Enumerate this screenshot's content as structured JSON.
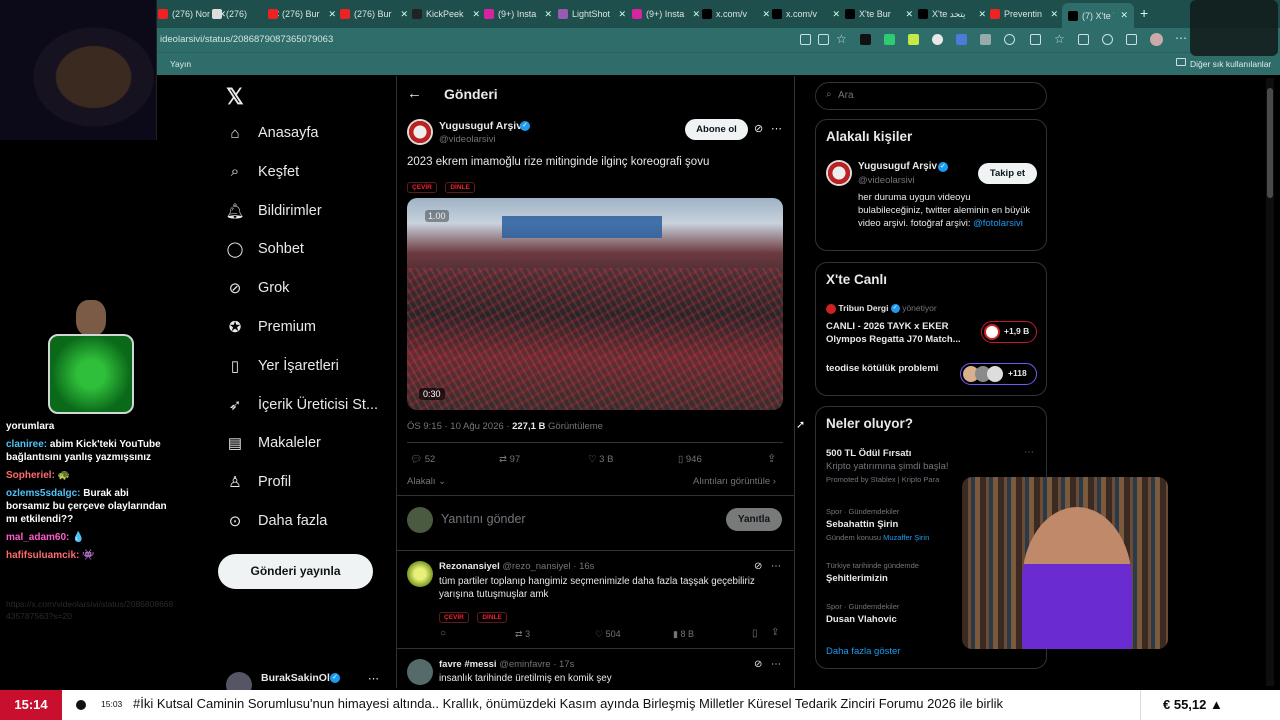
{
  "browser": {
    "tabs": [
      {
        "label": "(276) Nor"
      },
      {
        "label": "(276)"
      },
      {
        "label": "(276) Bur"
      },
      {
        "label": "(276) Bur"
      },
      {
        "label": "KickPeek"
      },
      {
        "label": "(9+) Insta"
      },
      {
        "label": "LightShot"
      },
      {
        "label": "(9+) Insta"
      },
      {
        "label": "x.com/v"
      },
      {
        "label": "x.com/v"
      },
      {
        "label": "X'te Bur"
      },
      {
        "label": "X'te يتحد"
      },
      {
        "label": "Preventin"
      },
      {
        "label": "(7) X'te Y"
      }
    ],
    "url": "ideolarsivi/status/2086879087365079063",
    "bookmark_left": "Yayın",
    "bookmark_right": "Diğer sık kullanılanlar"
  },
  "nav": {
    "items": [
      {
        "label": "Anasayfa",
        "icon": "home-icon"
      },
      {
        "label": "Keşfet",
        "icon": "search-icon"
      },
      {
        "label": "Bildirimler",
        "icon": "bell-icon"
      },
      {
        "label": "Sohbet",
        "icon": "chat-icon"
      },
      {
        "label": "Grok",
        "icon": "grok-icon"
      },
      {
        "label": "Premium",
        "icon": "premium-icon"
      },
      {
        "label": "Yer İşaretleri",
        "icon": "bookmark-icon"
      },
      {
        "label": "İçerik Üreticisi St...",
        "icon": "rocket-icon"
      },
      {
        "label": "Makaleler",
        "icon": "article-icon"
      },
      {
        "label": "Profil",
        "icon": "profile-icon"
      },
      {
        "label": "Daha fazla",
        "icon": "more-icon"
      }
    ],
    "post_button": "Gönderi yayınla",
    "account_name": "BurakSakinOl"
  },
  "main": {
    "header_title": "Gönderi",
    "tweet": {
      "author_name": "Yugusuguf Arşiv",
      "author_handle": "@videolarsivi",
      "subscribe": "Abone ol",
      "text": "2023 ekrem imamoğlu rize mitinginde ilginç koreografi şovu",
      "tag_translate": "ÇEVİR",
      "tag_listen": "DİNLE",
      "video_speed": "1.00",
      "video_duration": "0:30",
      "time": "ÖS 9:15 · 10 Ağu 2026 · ",
      "views": "227,1 B",
      "views_label": " Görüntüleme",
      "replies": "52",
      "retweets": "97",
      "likes": "3 B",
      "bookmarks": "946",
      "related": "Alakalı",
      "quotes": "Alıntıları görüntüle"
    },
    "reply_box": {
      "placeholder": "Yanıtını gönder",
      "button": "Yanıtla"
    },
    "replies": [
      {
        "name": "Rezonansiyel",
        "handle": "@rezo_nansiyel · 16s",
        "text": "tüm partiler toplanıp hangimiz seçmenimizle daha fazla taşşak geçebiliriz yarışına tutuşmuşlar amk",
        "retweets": "3",
        "likes": "504",
        "views": "8 B"
      },
      {
        "name": "favre #messi",
        "handle": "@eminfavre · 17s",
        "text": "insanlık tarihinde üretilmiş en komik şey"
      }
    ]
  },
  "sidebar": {
    "search_placeholder": "Ara",
    "related_title": "Alakalı kişiler",
    "related_person": {
      "name": "Yugusuguf Arşiv",
      "handle": "@videolarsivi",
      "follow": "Takip et",
      "bio": "her duruma uygun videoyu bulabileceğiniz, twitter aleminin en büyük video arşivi. fotoğraf arşivi: ",
      "bio_link": "@fotolarsivi"
    },
    "live_title": "X'te Canlı",
    "live": [
      {
        "host": "Tribun Dergi",
        "role": "yönetiyor",
        "title": "CANLI - 2026 TAYK x EKER Olympos Regatta J70 Match...",
        "count": "+1,9 B"
      },
      {
        "title": "teodise kötülük problemi",
        "count": "+118"
      }
    ],
    "trends_title": "Neler oluyor?",
    "trends": [
      {
        "title": "500 TL Ödül Fırsatı",
        "sub": "Kripto yatırımına şimdi başla!",
        "meta": "Promoted by Stablex | Kripto Para"
      },
      {
        "meta": "Spor · Gündemdekiler",
        "title": "Sebahattin Şirin",
        "sub": "Gündem konusu ",
        "link": "Muzaffer Şirin"
      },
      {
        "meta": "Türkiye tarihinde gündemde",
        "title": "Şehitlerimizin"
      },
      {
        "meta": "Spor · Gündemdekiler",
        "title": "Dusan Vlahovic"
      }
    ],
    "show_more": "Daha fazla göster"
  },
  "stream_chat": {
    "lines": [
      {
        "user": "",
        "text": "yorumlara"
      },
      {
        "user": "claniree:",
        "text": " abim Kick'teki YouTube bağlantısını yanlış yazmışsınız"
      },
      {
        "user": "Sopheriel:",
        "text": " 🐢"
      },
      {
        "user": "ozlems5sdalgc:",
        "text": " Burak abi borsamız bu çerçeve olaylarından mı etkilendi??"
      },
      {
        "user": "mal_adam60:",
        "text": " 💧"
      },
      {
        "user": "hafifsuluamcik:",
        "text": " 👾"
      }
    ],
    "faded_text": "https://x.com/videolarsivi/status/2086808668435787563?s=20"
  },
  "ticker": {
    "time": "15:14",
    "small_time": "15:03",
    "text": "#İki Kutsal Caminin Sorumlusu'nun himayesi altında.. Krallık, önümüzdeki Kasım ayında Birleşmiş Milletler Küresel Tedarik Zinciri Forumu 2026 ile birlik",
    "price": "€ 55,12 ▲"
  },
  "colors": {
    "accent": "#1d9bf0",
    "browser": "#2e6d69",
    "tag_red": "#f4212e"
  }
}
